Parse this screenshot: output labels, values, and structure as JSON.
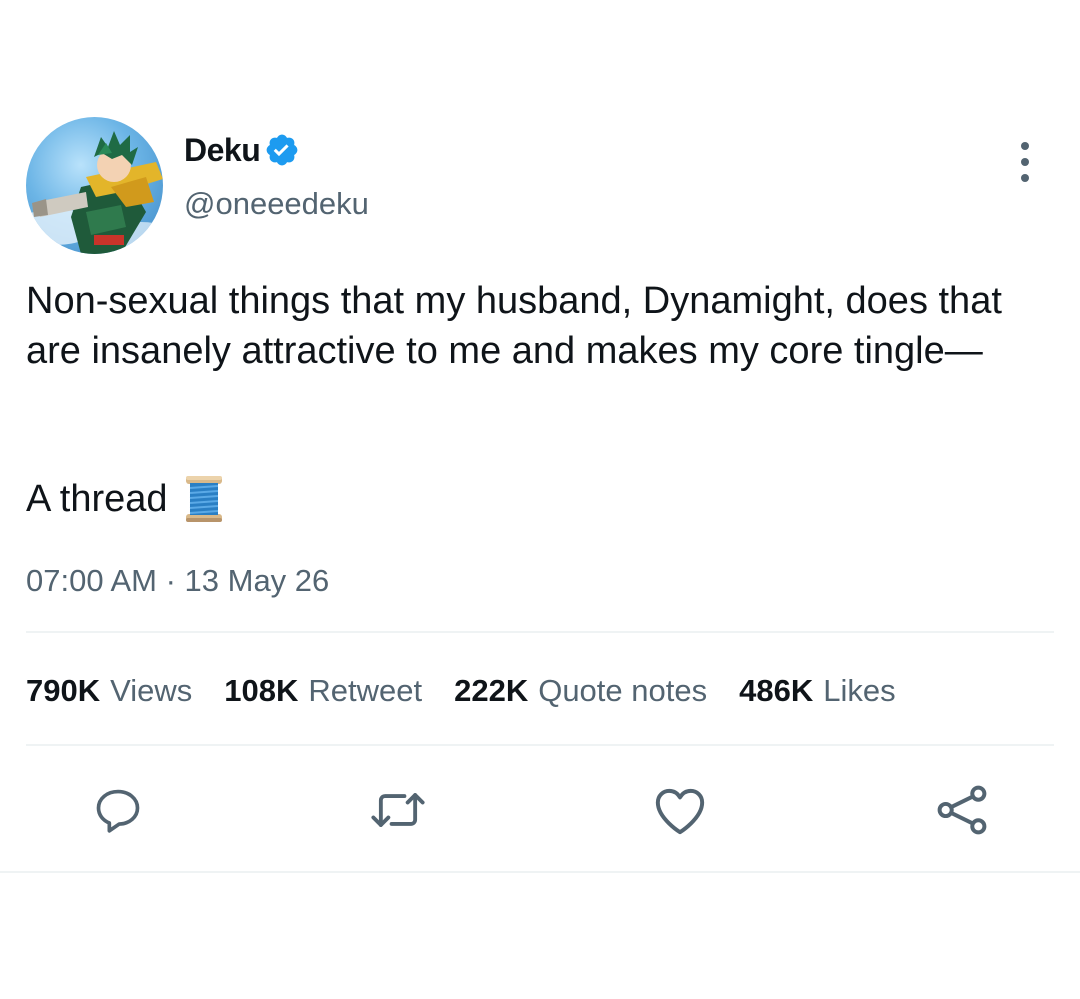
{
  "author": {
    "display_name": "Deku",
    "handle": "@oneeedeku",
    "verified": true,
    "avatar_icon": "anime-character-avatar"
  },
  "tweet": {
    "text": "Non-sexual things that my husband, Dynamight, does that are insanely attractive to me and makes my core tingle—",
    "thread_text": "A thread",
    "thread_emoji": "spool-of-thread-icon",
    "timestamp": "07:00 AM · 13 May 26"
  },
  "stats": [
    {
      "count": "790K",
      "label": "Views"
    },
    {
      "count": "108K",
      "label": "Retweet"
    },
    {
      "count": "222K",
      "label": "Quote notes"
    },
    {
      "count": "486K",
      "label": "Likes"
    }
  ],
  "actions": [
    "reply-icon",
    "retweet-icon",
    "like-icon",
    "share-icon"
  ],
  "colors": {
    "text_primary": "#0f1419",
    "text_secondary": "#536471",
    "verified": "#1d9bf0",
    "divider": "#eff3f4"
  }
}
